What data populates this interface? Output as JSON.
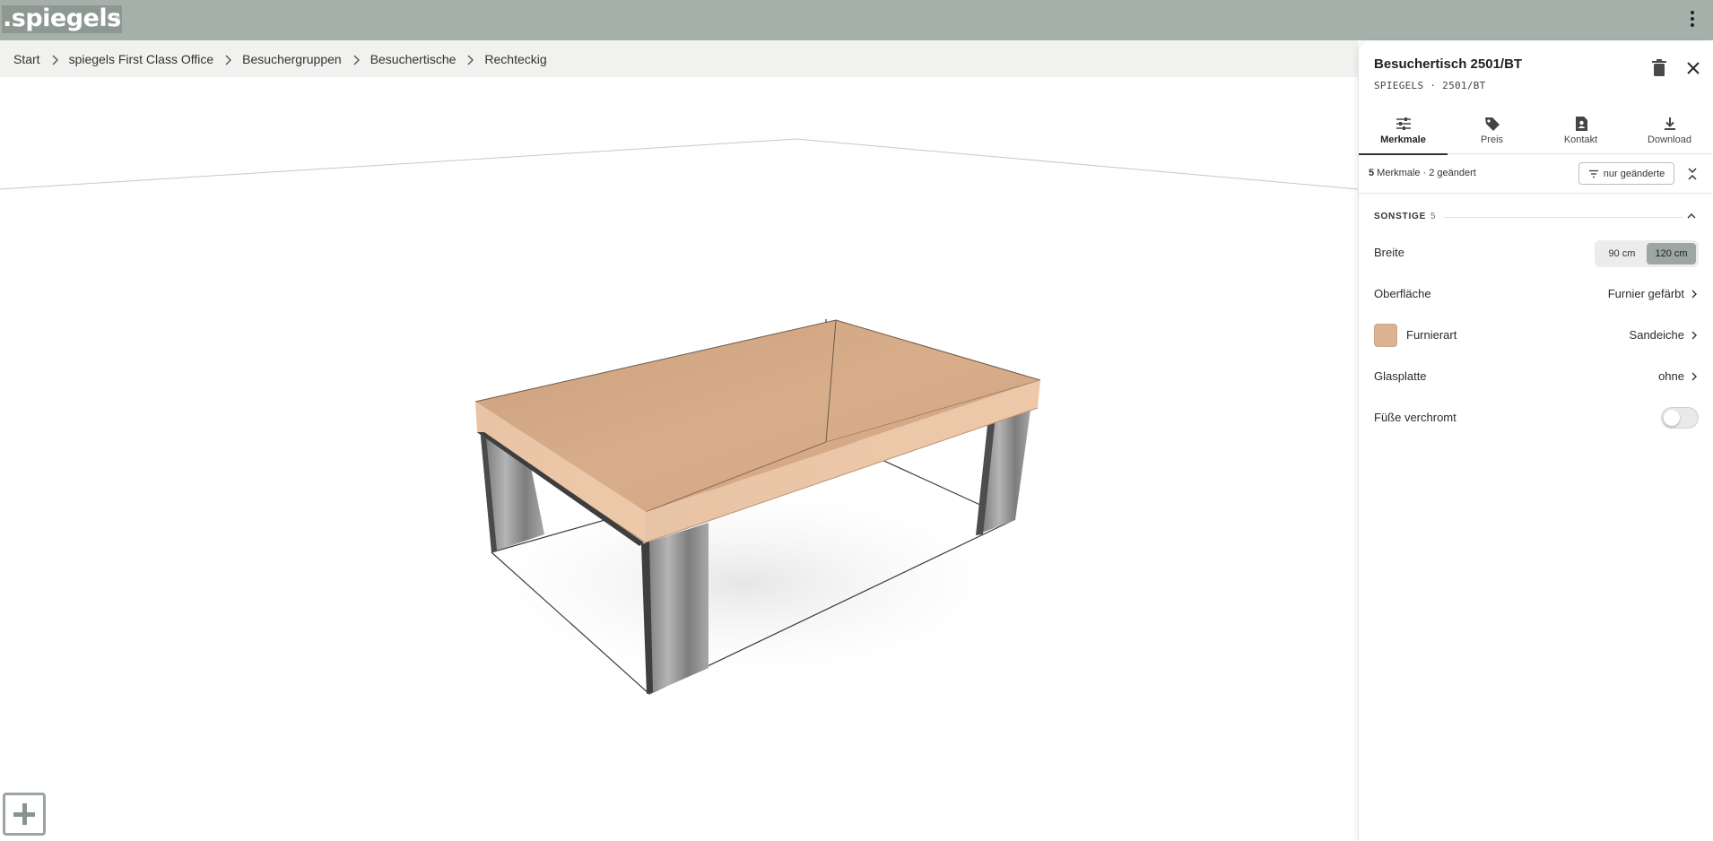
{
  "header": {
    "logo_text": ".spiegels",
    "logo_mark": "®",
    "menu_icon": "more-vertical-icon"
  },
  "breadcrumb": [
    {
      "label": "Start"
    },
    {
      "label": "spiegels First Class Office"
    },
    {
      "label": "Besuchergruppen"
    },
    {
      "label": "Besuchertische"
    },
    {
      "label": "Rechteckig"
    }
  ],
  "viewport": {
    "add_icon": "plus-square-icon",
    "table_top_color": "#d6a884",
    "edge_color": "#eac4a4",
    "leg_color": "#8e8e8e"
  },
  "panel": {
    "title": "Besuchertisch 2501/BT",
    "subtitle": "SPIEGELS · 2501/BT",
    "tabs": [
      {
        "label": "Merkmale",
        "icon": "sliders-icon",
        "active": true
      },
      {
        "label": "Preis",
        "icon": "price-tag-icon",
        "active": false
      },
      {
        "label": "Kontakt",
        "icon": "contact-icon",
        "active": false
      },
      {
        "label": "Download",
        "icon": "download-icon",
        "active": false
      }
    ],
    "summary_count": "5",
    "summary_text": " Merkmale · 2 geändert",
    "filter_label": "nur geänderte",
    "section": {
      "title": "SONSTIGE",
      "count": "5"
    },
    "features": {
      "breite": {
        "label": "Breite",
        "options": [
          "90 cm",
          "120 cm"
        ],
        "selected": "120 cm"
      },
      "oberflaeche": {
        "label": "Oberfläche",
        "value": "Furnier gefärbt"
      },
      "furnierart": {
        "label": "Furnierart",
        "value": "Sandeiche",
        "swatch_color": "#dbb393"
      },
      "glasplatte": {
        "label": "Glasplatte",
        "value": "ohne"
      },
      "fuesse": {
        "label": "Füße verchromt",
        "enabled": false
      }
    }
  }
}
